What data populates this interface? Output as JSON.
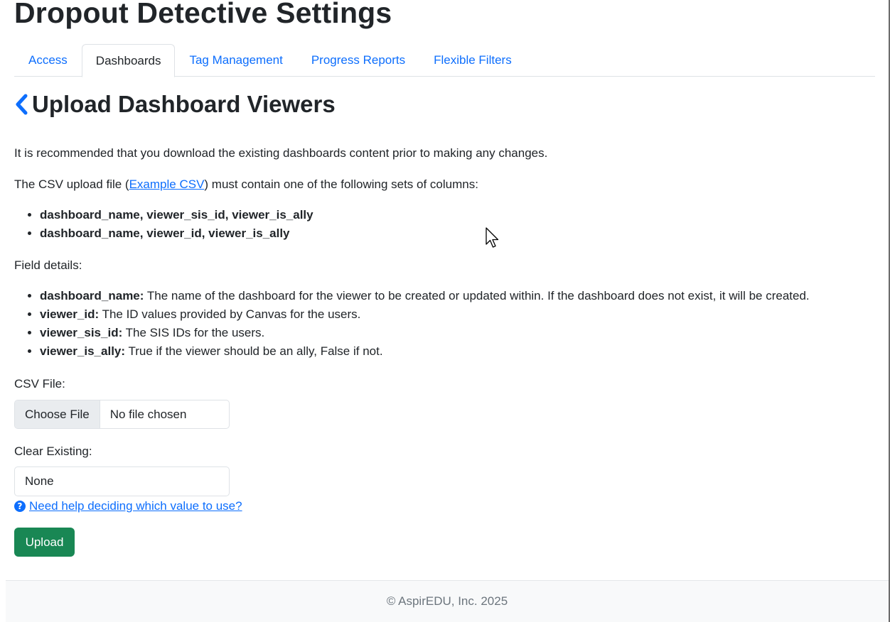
{
  "app": {
    "title": "Dropout Detective Settings"
  },
  "tabs": [
    {
      "label": "Access"
    },
    {
      "label": "Dashboards",
      "active": true
    },
    {
      "label": "Tag Management"
    },
    {
      "label": "Progress Reports"
    },
    {
      "label": "Flexible Filters"
    }
  ],
  "page": {
    "back_icon": "chevron-left-icon",
    "heading": "Upload Dashboard Viewers",
    "recommendation": "It is recommended that you download the existing dashboards content prior to making any changes.",
    "csv_intro_before": "The CSV upload file (",
    "csv_intro_link": "Example CSV",
    "csv_intro_after": ") must contain one of the following sets of columns:",
    "column_sets": [
      "dashboard_name, viewer_sis_id, viewer_is_ally",
      "dashboard_name, viewer_id, viewer_is_ally"
    ],
    "field_details_label": "Field details:",
    "fields": [
      {
        "name": "dashboard_name:",
        "desc": " The name of the dashboard for the viewer to be created or updated within. If the dashboard does not exist, it will be created."
      },
      {
        "name": "viewer_id:",
        "desc": " The ID values provided by Canvas for the users."
      },
      {
        "name": "viewer_sis_id:",
        "desc": " The SIS IDs for the users."
      },
      {
        "name": "viewer_is_ally:",
        "desc": " True if the viewer should be an ally, False if not."
      }
    ]
  },
  "form": {
    "csv_label": "CSV File:",
    "choose_file_label": "Choose File",
    "file_status": "No file chosen",
    "clear_label": "Clear Existing:",
    "clear_value": "None",
    "help_icon": "question-circle-icon",
    "help_link": "Need help deciding which value to use?",
    "upload_label": "Upload"
  },
  "footer": {
    "text": "© AspirEDU, Inc. 2025"
  },
  "colors": {
    "link": "#0d6efd",
    "upload": "#198754",
    "footer_bg": "#f8f9fa"
  }
}
